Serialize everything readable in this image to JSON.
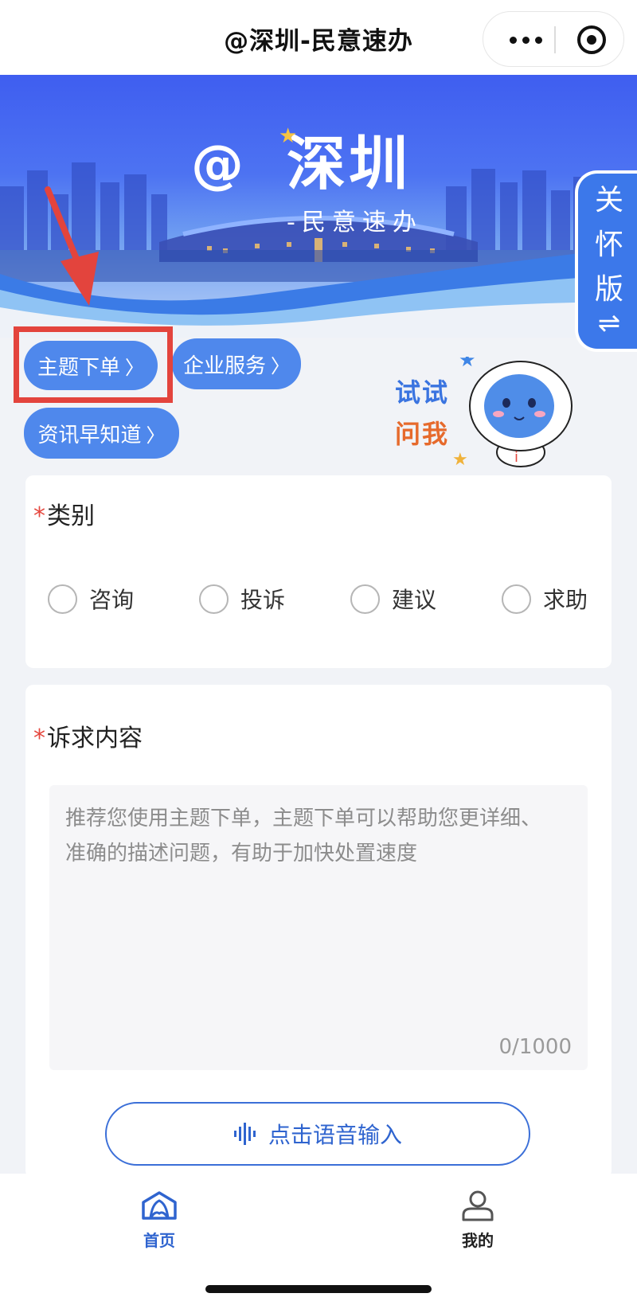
{
  "nav": {
    "title": "@深圳-民意速办"
  },
  "banner": {
    "logo_at": "@",
    "logo_city": "深圳",
    "subtitle": "-民意速办"
  },
  "care_tab": {
    "label": "关怀版",
    "swap_glyph": "⇌"
  },
  "pills": {
    "theme_order": "主题下单",
    "enterprise": "企业服务",
    "news": "资讯早知道",
    "chevron": "〉"
  },
  "ask_me": {
    "line1": "试试",
    "line2": "问我"
  },
  "category": {
    "required_mark": "*",
    "label": "类别",
    "options": [
      "咨询",
      "投诉",
      "建议",
      "求助"
    ]
  },
  "content": {
    "required_mark": "*",
    "label": "诉求内容",
    "placeholder": "推荐您使用主题下单，主题下单可以帮助您更详细、准确的描述问题，有助于加快处置速度",
    "counter": "0/1000",
    "voice_button": "点击语音输入"
  },
  "tabbar": {
    "home": "首页",
    "mine": "我的"
  },
  "colors": {
    "brand_blue": "#4f88ec",
    "highlight_red": "#e3443d",
    "required_red": "#e5483f",
    "active_tab": "#2f64cf"
  }
}
